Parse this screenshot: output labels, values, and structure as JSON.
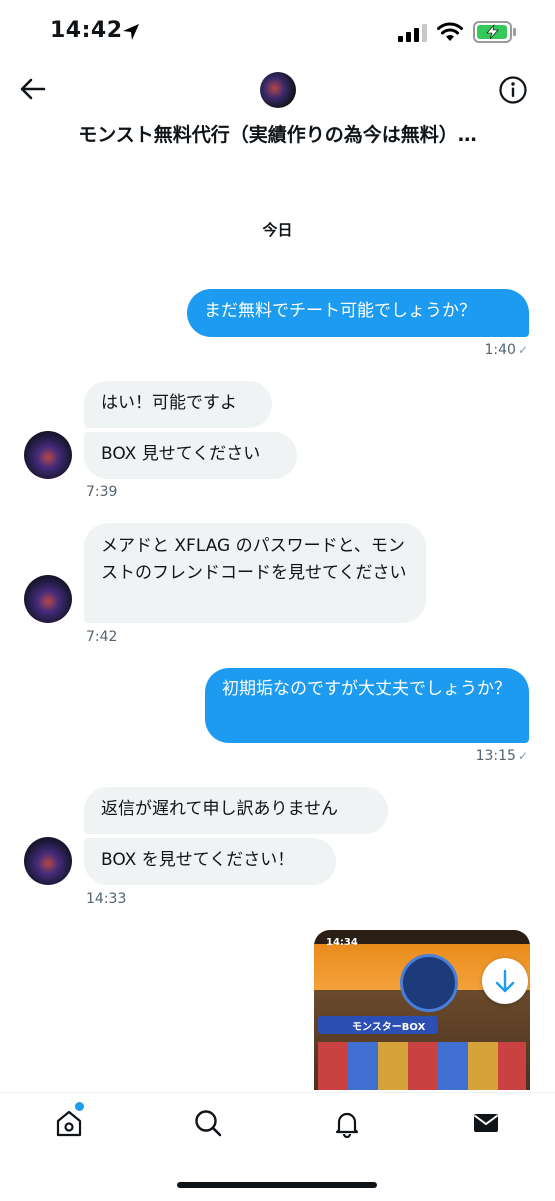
{
  "status_bar": {
    "time": "14:42"
  },
  "header": {
    "title": "モンスト無料代行（実績作りの為今は無料）…"
  },
  "date_divider": "今日",
  "messages": [
    {
      "side": "out",
      "text": "まだ無料でチート可能でしょうか？",
      "time": "1:40"
    },
    {
      "side": "in",
      "texts": [
        "はい！可能ですよ",
        "BOX 見せてください"
      ],
      "time": "7:39"
    },
    {
      "side": "in",
      "text": "メアドと XFLAG のパスワードと、モンストのフレンドコードを見せてください",
      "time": "7:42"
    },
    {
      "side": "out",
      "text": "初期垢なのですが大丈夫でしょうか？",
      "time": "13:15"
    },
    {
      "side": "in",
      "texts": [
        "返信が遅れて申し訳ありません",
        "BOX を見せてください！"
      ],
      "time": "14:33"
    }
  ],
  "attachment": {
    "clock": "14:34",
    "box_label": "モンスターBOX"
  },
  "tabs": [
    "home",
    "search",
    "notifications",
    "messages"
  ],
  "colors": {
    "accent": "#1d9bf0",
    "incoming_bubble": "#eff3f4"
  }
}
